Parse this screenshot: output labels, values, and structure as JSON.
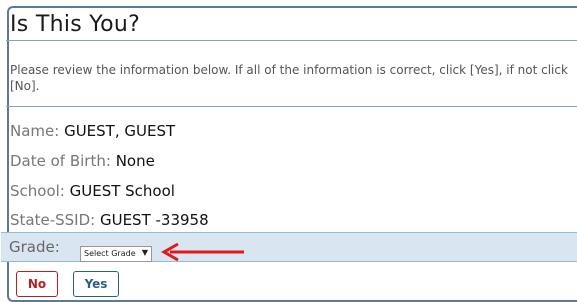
{
  "dialog": {
    "title": "Is This You?",
    "instructions": "Please review the information below. If all of the information is correct, click [Yes], if not click [No]."
  },
  "fields": [
    {
      "label": "Name: ",
      "value": "GUEST, GUEST"
    },
    {
      "label": "Date of Birth: ",
      "value": "None"
    },
    {
      "label": "School: ",
      "value": "GUEST School"
    },
    {
      "label": "State-SSID: ",
      "value": "GUEST -33958"
    }
  ],
  "grade": {
    "label": "Grade:",
    "selected": "Select Grade"
  },
  "buttons": {
    "no_label": "No",
    "yes_label": "Yes"
  },
  "colors": {
    "arrow": "#e01b1b",
    "no_button": "#b22222",
    "yes_button": "#2b5f8a",
    "grade_band": "#d9e6f2"
  }
}
